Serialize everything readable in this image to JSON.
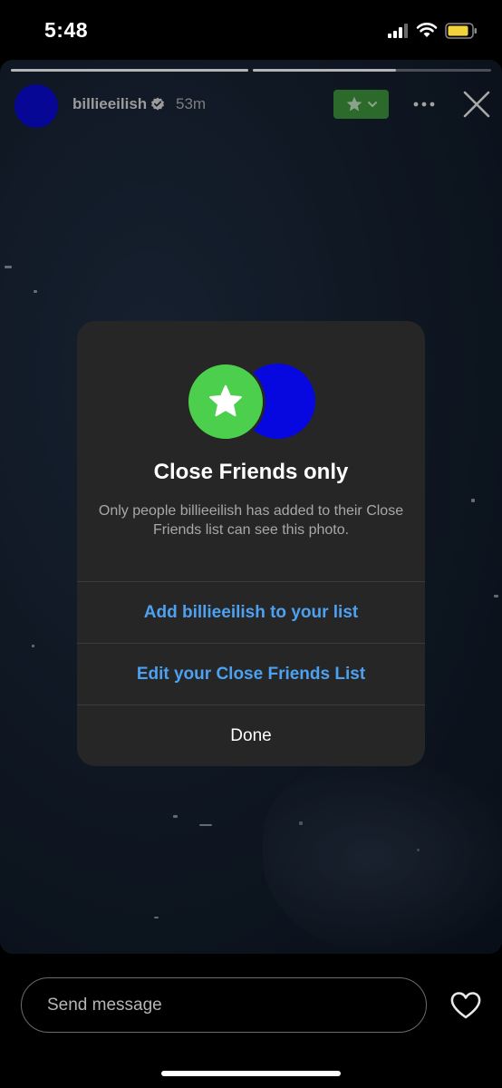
{
  "status_bar": {
    "time": "5:48",
    "icons": [
      "signal-icon",
      "wifi-icon",
      "battery-icon"
    ],
    "battery_color": "#f2d33a"
  },
  "story": {
    "progress_segments": [
      {
        "state": "complete",
        "fill": 1.0
      },
      {
        "state": "current",
        "fill": 0.6
      }
    ],
    "username": "billieeilish",
    "verified": true,
    "time_ago": "53m",
    "close_friends_badge_color": "#3a8e3a",
    "icons": [
      "verified-icon",
      "star-icon",
      "chevron-down-icon",
      "more-icon",
      "close-icon"
    ]
  },
  "dialog": {
    "title": "Close Friends only",
    "body": "Only people billieeilish has added to their Close Friends list can see this photo.",
    "add_button": "Add billieeilish to your list",
    "edit_button": "Edit your Close Friends List",
    "done_button": "Done",
    "accent_color": "#4ea0f0",
    "green_color": "#4ccf4c",
    "blue_color": "#0707e0"
  },
  "bottom_bar": {
    "message_placeholder": "Send message",
    "icons": [
      "heart-icon"
    ]
  }
}
